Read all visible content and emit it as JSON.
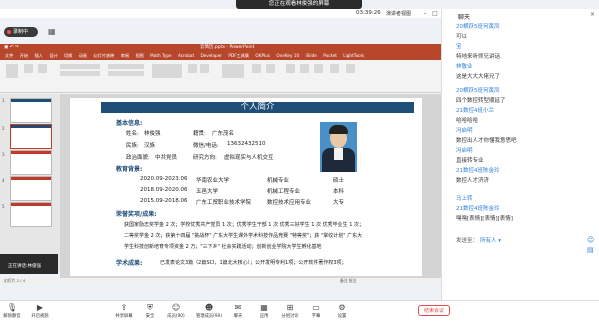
{
  "banner": {
    "share_text": "您正在观看林俊强的屏幕",
    "menu": "···"
  },
  "meeting": {
    "timer": "03:39:26",
    "layout_label": "演讲者视图",
    "record_label": "录制中"
  },
  "ppt": {
    "window_title": "云简历.pptx - PowerPoint",
    "tabs": [
      "文件",
      "开始",
      "插入",
      "设计",
      "切换",
      "动画",
      "幻灯片放映",
      "审阅",
      "视图",
      "Math Type",
      "Acrobat",
      "Developer",
      "PDF工具集",
      "OKPlus",
      "OneKey 10",
      "iSlide",
      "Pocket",
      "LightTools"
    ],
    "status_left": "幻灯片 2 / 4",
    "status_right": "备注  批注"
  },
  "slide": {
    "header": "个人简介",
    "sec_basic": "基本信息:",
    "name_label": "姓名:",
    "name_value": "林俊强",
    "origin_label": "籍贯:",
    "origin_value": "广东茂名",
    "ethnicity_label": "民族:",
    "ethnicity_value": "汉族",
    "wechat_label": "微信/电话:",
    "wechat_value": "13632432510",
    "politics_label": "政治面貌:",
    "politics_value": "中共党员",
    "research_label": "研究方向:",
    "research_value": "虚拟现实与人机交互",
    "sec_edu": "教育背景:",
    "edu": [
      {
        "period": "2020.09-2023.06",
        "school": "华南农业大学",
        "major": "机械专业",
        "degree": "硕士"
      },
      {
        "period": "2018.09-2020.06",
        "school": "五邑大学",
        "major": "机械工程专业",
        "degree": "本科"
      },
      {
        "period": "2015.09-2018.06",
        "school": "广东工贸职业技术学院",
        "major": "数控技术应用专业",
        "degree": "大专"
      }
    ],
    "sec_honor": "荣誉奖项/成果:",
    "honor_1": "获国家励志奖学金 2 次；学校优秀共产党员 1 次；优秀学生干部 1 次 优秀三好学生 1 次 优秀毕业生 1 次；",
    "honor_2": "二等奖学金 2 次；获第十四届 \"挑战杯\" 广东大学生课外学术科技作品竞赛 \"特等奖\"；获 \"掌纹计划\" 广东大",
    "honor_3": "学生科技创新培育专项资金 2 万；\"三下乡\" 社会实践活动；创新创业学院大学生孵化基地",
    "sec_research": "学术成果:",
    "research_text": "已发表论文3篇（2篇SCI，1篇北大核心）；公开发明专利1项；公开软件著作权3项；"
  },
  "video": {
    "label": "正在讲话:林俊强"
  },
  "chat": {
    "title": "聊天",
    "messages": [
      {
        "name": "20横跃5班何黄凤",
        "text": "可以"
      },
      {
        "name": "宝",
        "text": "特地来听师兄讲话"
      },
      {
        "name": "林敬业",
        "text": "这是大大大佬兄了"
      },
      {
        "name": "20横跃5班何黄凤",
        "text": "四个数控转型顺延了"
      },
      {
        "name": "21数控4班小兰",
        "text": "哈哈哈哈"
      },
      {
        "name": "冯启明",
        "text": "数控出人才你懂我意思吧"
      },
      {
        "name": "冯启明",
        "text": "直接转专业"
      },
      {
        "name": "21数控4班陈金玲",
        "text": "数控人才济济"
      },
      {
        "name": "马上转",
        "text": ""
      },
      {
        "name": "21数控4班陈金玲",
        "text": "嘿嘿[表情][表情][表情]"
      }
    ],
    "to_label": "发送至：",
    "to_value": "所有人 ▾"
  },
  "toolbar": {
    "items": [
      "解除静音",
      "开启视频",
      "共享屏幕",
      "安全",
      "成员(90)",
      "管理成员(90)",
      "聊天",
      "应用",
      "分组讨论",
      "字幕",
      "设置",
      "结束"
    ],
    "end_label": "结束会议"
  }
}
